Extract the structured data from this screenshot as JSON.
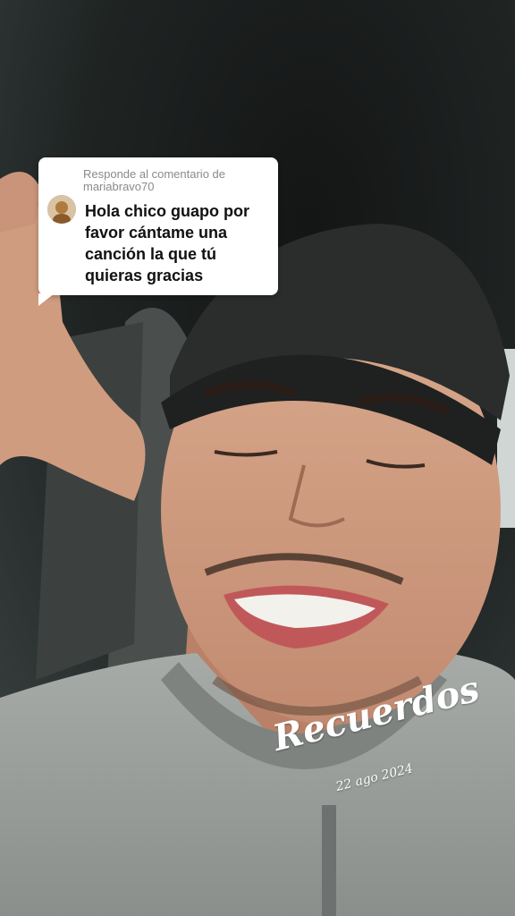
{
  "reply_card": {
    "header": "Responde al comentario de mariabravo70",
    "comment": "Hola chico guapo por favor cántame una canción la que tú quieras gracias"
  },
  "sticker": {
    "title": "Recuerdos",
    "date": "22 ago 2024"
  },
  "colors": {
    "card_bg": "#ffffff",
    "header_text": "#8a8a8a",
    "comment_text": "#111111"
  },
  "icons": {
    "avatar": "commenter-avatar"
  }
}
